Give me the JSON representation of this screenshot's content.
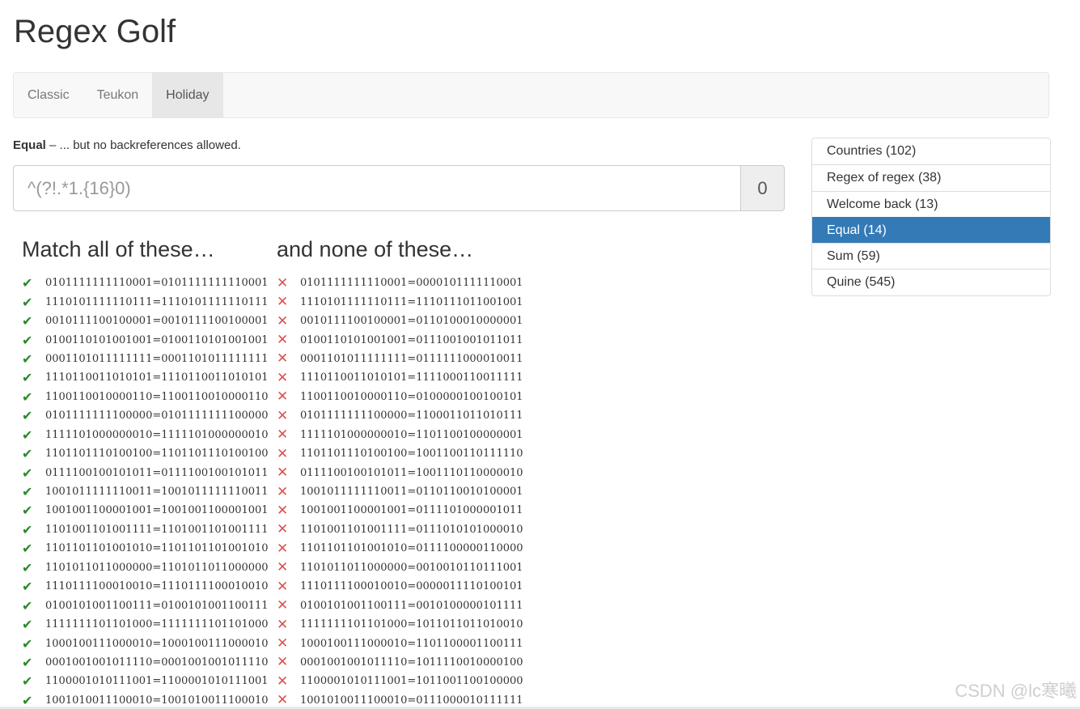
{
  "title": "Regex Golf",
  "nav": {
    "tabs": [
      {
        "label": "Classic",
        "active": false
      },
      {
        "label": "Teukon",
        "active": false
      },
      {
        "label": "Holiday",
        "active": true
      }
    ]
  },
  "level": {
    "name": "Equal",
    "description": "– ... but no backreferences allowed."
  },
  "regex": {
    "placeholder": "^(?!.*1.{16}0)",
    "score": "0"
  },
  "match": {
    "heading": "Match all of these…",
    "items": [
      "0101111111110001=0101111111110001",
      "1110101111110111=1110101111110111",
      "0010111100100001=0010111100100001",
      "0100110101001001=0100110101001001",
      "0001101011111111=0001101011111111",
      "1110110011010101=1110110011010101",
      "1100110010000110=1100110010000110",
      "0101111111100000=0101111111100000",
      "1111101000000010=1111101000000010",
      "1101101110100100=1101101110100100",
      "0111100100101011=0111100100101011",
      "1001011111110011=1001011111110011",
      "1001001100001001=1001001100001001",
      "1101001101001111=1101001101001111",
      "1101101101001010=1101101101001010",
      "1101011011000000=1101011011000000",
      "1110111100010010=1110111100010010",
      "0100101001100111=0100101001100111",
      "1111111101101000=1111111101101000",
      "1000100111000010=1000100111000010",
      "0001001001011110=0001001001011110",
      "1100001010111001=1100001010111001",
      "1001010011100010=1001010011100010"
    ]
  },
  "none": {
    "heading": "and none of these…",
    "items": [
      "0101111111110001=0000101111110001",
      "1110101111110111=1110111011001001",
      "0010111100100001=0110100010000001",
      "0100110101001001=0111001001011011",
      "0001101011111111=0111111000010011",
      "1110110011010101=1111000110011111",
      "1100110010000110=0100000100100101",
      "0101111111100000=1100011011010111",
      "1111101000000010=1101100100000001",
      "1101101110100100=1001100110111110",
      "0111100100101011=1001110110000010",
      "1001011111110011=0110110010100001",
      "1001001100001001=0111101000001011",
      "1101001101001111=0111010101000010",
      "1101101101001010=0111100000110000",
      "1101011011000000=0010010110111001",
      "1110111100010010=0000011110100101",
      "0100101001100111=0010100000101111",
      "1111111101101000=1011011011010010",
      "1000100111000010=1101100001100111",
      "0001001001011110=1011110010000100",
      "1100001010111001=1011001100100000",
      "1001010011100010=0111000010111111"
    ]
  },
  "levels": [
    {
      "label": "Countries (102)",
      "active": false
    },
    {
      "label": "Regex of regex (38)",
      "active": false
    },
    {
      "label": "Welcome back (13)",
      "active": false
    },
    {
      "label": "Equal (14)",
      "active": true
    },
    {
      "label": "Sum (59)",
      "active": false
    },
    {
      "label": "Quine (545)",
      "active": false
    }
  ],
  "icons": {
    "match": "check-icon",
    "none": "cross-icon"
  },
  "colors": {
    "active_level": "#337ab7",
    "check": "#2a8a2a",
    "cross": "#d9534f"
  },
  "watermark": "CSDN @lc寒曦"
}
